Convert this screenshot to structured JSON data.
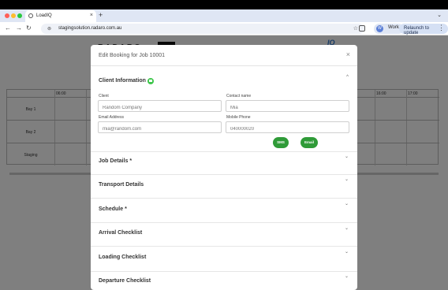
{
  "browser": {
    "tab_title": "LoadIQ",
    "new_tab": "+",
    "tab_close": "×",
    "tabs_menu": "⌄",
    "url": "stagingsolution.radaro.com.au",
    "profile_initial": "W",
    "profile_label": "Work",
    "relaunch_label": "Relaunch to update",
    "back": "←",
    "forward": "→",
    "reload": "↻",
    "lock": "⊚",
    "bookmark": "☆",
    "menu": "⋮",
    "traffic_lights": [
      "#ff5f57",
      "#febc2e",
      "#28c840"
    ]
  },
  "background": {
    "timeline_times": [
      "06:00",
      "16:00",
      "17:00"
    ],
    "bays": [
      "Bay 1",
      "Bay 2",
      "Staging"
    ]
  },
  "modal": {
    "title": "Edit Booking for Job 10001",
    "close": "×",
    "client_section": {
      "title": "Client Information",
      "chevron": "^",
      "client_label": "Client",
      "client_placeholder": "Random Company",
      "contact_label": "Contact name",
      "contact_placeholder": "Mia",
      "email_label": "Email Address",
      "email_placeholder": "mia@random.com",
      "phone_label": "Mobile Phone",
      "phone_placeholder": "040000020",
      "sms_label": "SMS",
      "email_button_label": "Email"
    },
    "sections": [
      {
        "title": "Job Details",
        "required": "*",
        "chevron": "⌄"
      },
      {
        "title": "Transport Details",
        "required": "",
        "chevron": "⌄"
      },
      {
        "title": "Schedule",
        "required": "*",
        "chevron": "⌄"
      },
      {
        "title": "Arrival Checklist",
        "required": "",
        "chevron": "⌄"
      },
      {
        "title": "Loading Checklist",
        "required": "",
        "chevron": "⌄"
      },
      {
        "title": "Departure Checklist",
        "required": "",
        "chevron": "⌄"
      }
    ]
  },
  "colors": {
    "accent_green": "#2f9b38",
    "chat_green": "#3ec64b",
    "tabstrip": "#dfe6f4"
  }
}
